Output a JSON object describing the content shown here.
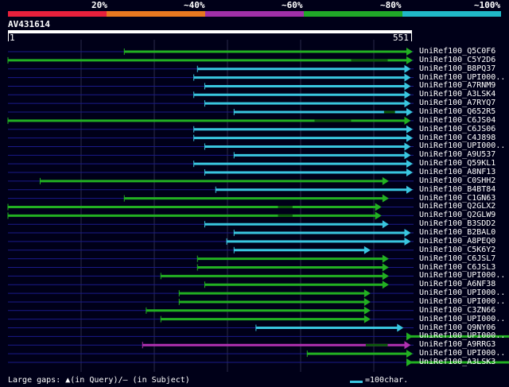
{
  "scale": {
    "labels": [
      "20%",
      "~40%",
      "~60%",
      "~80%",
      "~100%"
    ],
    "colors": [
      "#e8203c",
      "#e87820",
      "#a030a8",
      "#20a828",
      "#20b8c8"
    ]
  },
  "query": {
    "id": "AV431614",
    "start": "1",
    "end": "551",
    "length": 551
  },
  "identity_colors": {
    "cyan": "#39c6e0",
    "green": "#22b022",
    "magenta": "#b030b0"
  },
  "hits": [
    {
      "name": "UniRef100_Q5C0F6",
      "start": 160,
      "end": 651,
      "color": "green",
      "gaps": []
    },
    {
      "name": "UniRef100_C5Y2D6",
      "start": 1,
      "end": 629,
      "color": "green",
      "gaps": [
        [
          470,
          520
        ]
      ]
    },
    {
      "name": "UniRef100_B8PQ37",
      "start": 260,
      "end": 545,
      "color": "cyan",
      "gaps": []
    },
    {
      "name": "UniRef100_UPI000..",
      "start": 255,
      "end": 545,
      "color": "cyan",
      "gaps": []
    },
    {
      "name": "UniRef100_A7RNM9",
      "start": 270,
      "end": 545,
      "color": "cyan",
      "gaps": []
    },
    {
      "name": "UniRef100_A3LSK4",
      "start": 255,
      "end": 545,
      "color": "cyan",
      "gaps": []
    },
    {
      "name": "UniRef100_A7RYQ7",
      "start": 270,
      "end": 545,
      "color": "cyan",
      "gaps": []
    },
    {
      "name": "UniRef100_Q652R5",
      "start": 310,
      "end": 650,
      "color": "cyan",
      "gaps": [
        [
          515,
          530
        ]
      ]
    },
    {
      "name": "UniRef100_C6JS04",
      "start": 1,
      "end": 545,
      "color": "green",
      "gaps": [
        [
          420,
          470
        ]
      ]
    },
    {
      "name": "UniRef100_C6JS06",
      "start": 255,
      "end": 570,
      "color": "cyan",
      "gaps": []
    },
    {
      "name": "UniRef100_C4J898",
      "start": 255,
      "end": 570,
      "color": "cyan",
      "gaps": []
    },
    {
      "name": "UniRef100_UPI000..",
      "start": 270,
      "end": 545,
      "color": "cyan",
      "gaps": []
    },
    {
      "name": "UniRef100_A9U537",
      "start": 310,
      "end": 545,
      "color": "cyan",
      "gaps": []
    },
    {
      "name": "UniRef100_Q59KL1",
      "start": 255,
      "end": 570,
      "color": "cyan",
      "gaps": []
    },
    {
      "name": "UniRef100_A8NF13",
      "start": 270,
      "end": 570,
      "color": "cyan",
      "gaps": []
    },
    {
      "name": "UniRef100_C0SHH2",
      "start": 45,
      "end": 515,
      "color": "green",
      "gaps": []
    },
    {
      "name": "UniRef100_B4BT84",
      "start": 285,
      "end": 570,
      "color": "cyan",
      "gaps": []
    },
    {
      "name": "UniRef100_C1GN63",
      "start": 160,
      "end": 515,
      "color": "green",
      "gaps": []
    },
    {
      "name": "UniRef100_Q2GLX2",
      "start": 1,
      "end": 505,
      "color": "green",
      "gaps": [
        [
          370,
          390
        ]
      ]
    },
    {
      "name": "UniRef100_Q2GLW9",
      "start": 1,
      "end": 505,
      "color": "green",
      "gaps": [
        [
          370,
          390
        ]
      ]
    },
    {
      "name": "UniRef100_B3SDD2",
      "start": 270,
      "end": 515,
      "color": "cyan",
      "gaps": []
    },
    {
      "name": "UniRef100_B2BAL0",
      "start": 310,
      "end": 545,
      "color": "cyan",
      "gaps": []
    },
    {
      "name": "UniRef100_A8PEQ0",
      "start": 300,
      "end": 545,
      "color": "cyan",
      "gaps": []
    },
    {
      "name": "UniRef100_C5K6Y2",
      "start": 310,
      "end": 490,
      "color": "cyan",
      "gaps": []
    },
    {
      "name": "UniRef100_C6JSL7",
      "start": 260,
      "end": 515,
      "color": "green",
      "gaps": []
    },
    {
      "name": "UniRef100_C6JSL3",
      "start": 260,
      "end": 515,
      "color": "green",
      "gaps": []
    },
    {
      "name": "UniRef100_UPI000..",
      "start": 210,
      "end": 515,
      "color": "green",
      "gaps": []
    },
    {
      "name": "UniRef100_A6NF38",
      "start": 270,
      "end": 515,
      "color": "green",
      "gaps": []
    },
    {
      "name": "UniRef100_UPI000..",
      "start": 235,
      "end": 490,
      "color": "green",
      "gaps": []
    },
    {
      "name": "UniRef100_UPI000..",
      "start": 235,
      "end": 490,
      "color": "green",
      "gaps": []
    },
    {
      "name": "UniRef100_C3ZN66",
      "start": 190,
      "end": 490,
      "color": "green",
      "gaps": []
    },
    {
      "name": "UniRef100_UPI000..",
      "start": 210,
      "end": 490,
      "color": "green",
      "gaps": []
    },
    {
      "name": "UniRef100_Q9NY06",
      "start": 340,
      "end": 535,
      "color": "cyan",
      "gaps": []
    },
    {
      "name": "UniRef100_UPI000..",
      "start": 745,
      "end": 1075,
      "color": "green",
      "gaps": []
    },
    {
      "name": "UniRef100_A9RRG3",
      "start": 185,
      "end": 545,
      "color": "magenta",
      "gaps": [
        [
          490,
          520
        ]
      ]
    },
    {
      "name": "UniRef100_UPI000..",
      "start": 410,
      "end": 650,
      "color": "green",
      "gaps": []
    },
    {
      "name": "UniRef100_A3LSK3",
      "start": 745,
      "end": 1075,
      "color": "green",
      "gaps": []
    }
  ],
  "footer": {
    "text": "Large gaps: ▲(in Query)/– (in Subject)"
  },
  "legend": {
    "text": "=100char."
  }
}
